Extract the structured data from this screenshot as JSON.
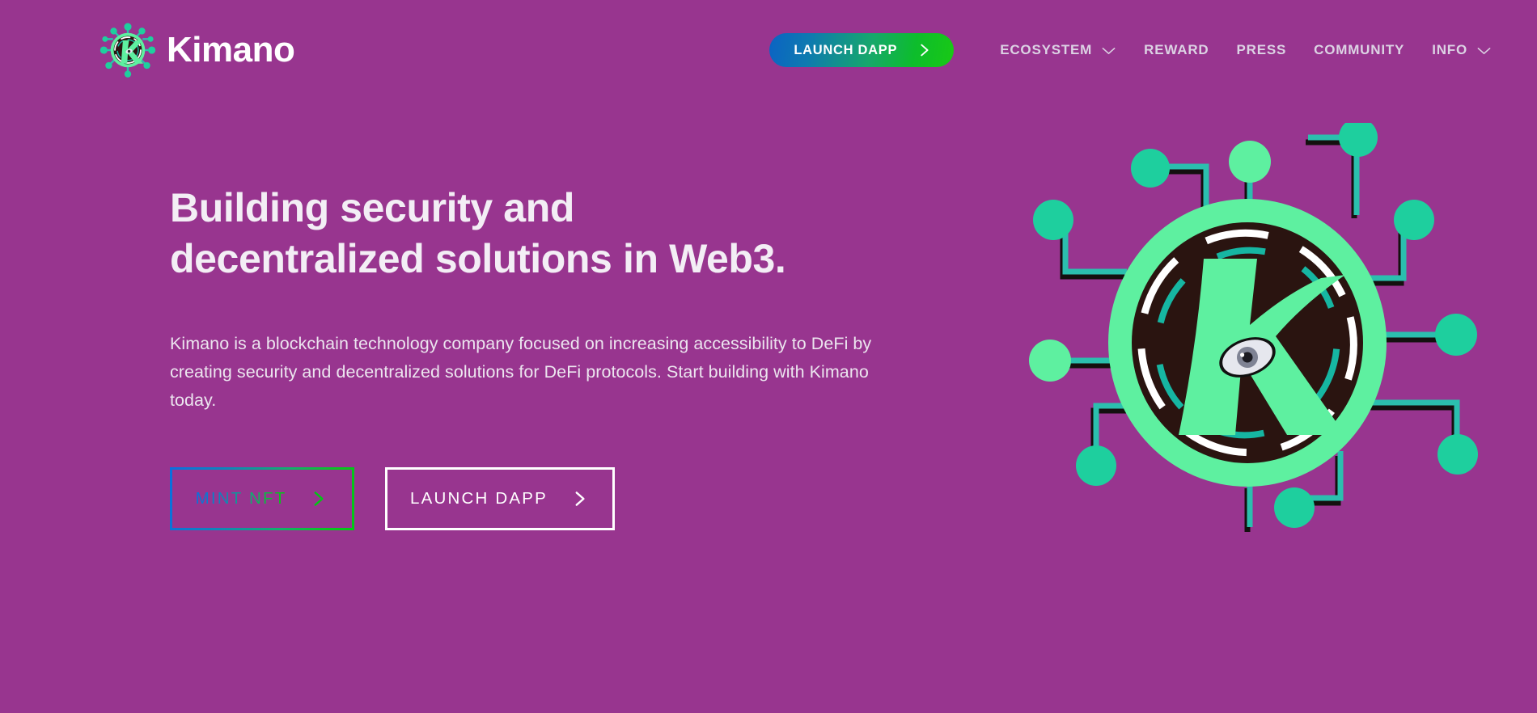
{
  "brand": {
    "name": "Kimano",
    "logo_icon": "kimano-circuit-k-logo-icon"
  },
  "header": {
    "cta": {
      "label": "LAUNCH DAPP",
      "icon": "chevron-right-icon",
      "gradient_from": "#0b63c4",
      "gradient_to": "#19c915"
    },
    "nav_items": [
      {
        "label": "ECOSYSTEM",
        "has_dropdown": true,
        "icon": "chevron-down-icon"
      },
      {
        "label": "REWARD",
        "has_dropdown": false,
        "icon": ""
      },
      {
        "label": "PRESS",
        "has_dropdown": false,
        "icon": ""
      },
      {
        "label": "COMMUNITY",
        "has_dropdown": false,
        "icon": ""
      },
      {
        "label": "INFO",
        "has_dropdown": true,
        "icon": "chevron-down-icon"
      }
    ]
  },
  "hero": {
    "title_line_1": "Building security and",
    "title_line_2": "decentralized solutions in Web3.",
    "paragraph": "Kimano is a blockchain technology company focused on increasing accessibility to DeFi by creating security and decentralized solutions for DeFi protocols. Start building with Kimano today.",
    "buttons": [
      {
        "label": "MINT NFT",
        "icon": "chevron-right-icon",
        "style": "gradient-outline"
      },
      {
        "label": "LAUNCH DAPP",
        "icon": "chevron-right-icon",
        "style": "white-outline"
      }
    ],
    "artwork_icon": "kimano-circuit-k-emblem-icon"
  },
  "colors": {
    "background": "#98358f",
    "accent_green": "#5ef0a0",
    "accent_teal": "#1ecf9e",
    "trace_teal": "#2bbfae",
    "dark": "#2a1410",
    "heading": "#f3eef5",
    "nav_text": "#dcd3e4",
    "white": "#ffffff",
    "gradient_blue": "#0a6fe0",
    "gradient_green": "#00c814"
  }
}
